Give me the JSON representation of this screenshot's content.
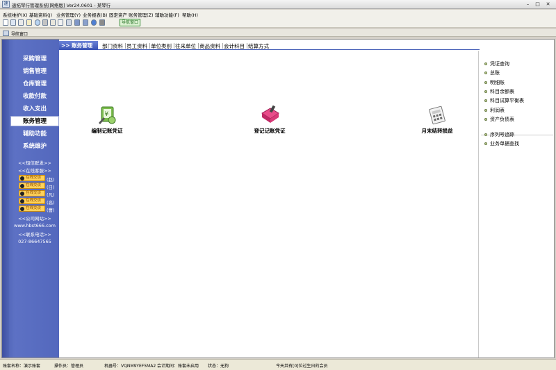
{
  "window": {
    "title": "速拓琴行管理系统[网络版] Ver24.0601 - 某琴行",
    "icon": "app-logo-icon",
    "controls": [
      "minimize",
      "maximize",
      "close"
    ]
  },
  "menu": [
    {
      "label": "系统维护(X)"
    },
    {
      "label": "基础资料(J)"
    },
    {
      "label": "业务管理(Y)"
    },
    {
      "label": "业务报表(B)"
    },
    {
      "label": "固定资产"
    },
    {
      "label": "账务管理(Z)"
    },
    {
      "label": "辅助功能(F)"
    },
    {
      "label": "帮助(H)"
    }
  ],
  "toolbar": {
    "icons": [
      "new-icon",
      "open-icon",
      "copy-icon",
      "list-icon",
      "user-icon",
      "tools-icon",
      "search-icon",
      "form-icon",
      "print-icon",
      "save-icon",
      "database-icon",
      "help-icon",
      "exit-icon"
    ],
    "nav_button_label": "导航窗口"
  },
  "nav_window": {
    "title": "导航窗口"
  },
  "sidebar": {
    "items": [
      {
        "label": "采购管理"
      },
      {
        "label": "销售管理"
      },
      {
        "label": "仓库管理"
      },
      {
        "label": "收款付款"
      },
      {
        "label": "收入支出"
      },
      {
        "label": "账务管理"
      },
      {
        "label": "辅助功能"
      },
      {
        "label": "系统维护"
      }
    ],
    "active_index": 5,
    "sms_text": "<<短信群发>>",
    "online_service_text": "<<在线客服>>",
    "qq_badges": [
      {
        "label": "在线交谈",
        "suffix": "(赵)"
      },
      {
        "label": "在线交谈",
        "suffix": "(日)"
      },
      {
        "label": "在线交谈",
        "suffix": "(凡)"
      },
      {
        "label": "在线交谈",
        "suffix": "(高)"
      },
      {
        "label": "在线交谈",
        "suffix": "(曹)"
      }
    ],
    "website_title": "<<公司网站>>",
    "website": "www.hbst666.com",
    "phone_title": "<<联系电话>>",
    "phone": "027-86647565"
  },
  "tabs": {
    "active": ">> 账务管理",
    "links": [
      "部门资料",
      "员工资料",
      "单位类别",
      "往来单位",
      "商品资料",
      "会计科目",
      "结算方式"
    ]
  },
  "workspace": {
    "functions": [
      {
        "label": "编制记账凭证",
        "icon": "compose-voucher-icon"
      },
      {
        "label": "登记记账凭证",
        "icon": "register-voucher-icon"
      },
      {
        "label": "月末结转损益",
        "icon": "month-end-closing-icon"
      }
    ]
  },
  "right_panel": {
    "group1": [
      "凭证查询",
      "总账",
      "明细账",
      "科目余额表",
      "科目试算平衡表",
      "利润表",
      "资产负债表"
    ],
    "group2": [
      "序列号追踪",
      "业务单据查找"
    ]
  },
  "status_bar": {
    "account_set": "账套名称：演示账套",
    "operator": "操作员：管理员",
    "machine": "机器号：VQNM9YEF5MA2 会计期间：账套未启用",
    "state": "状态：无狗",
    "birthday": "今天共有[0]位过生日的会员"
  },
  "colors": {
    "sidebar": "#5368bd",
    "tab_active": "#3952b4",
    "status_bar": "#ece9d8"
  }
}
